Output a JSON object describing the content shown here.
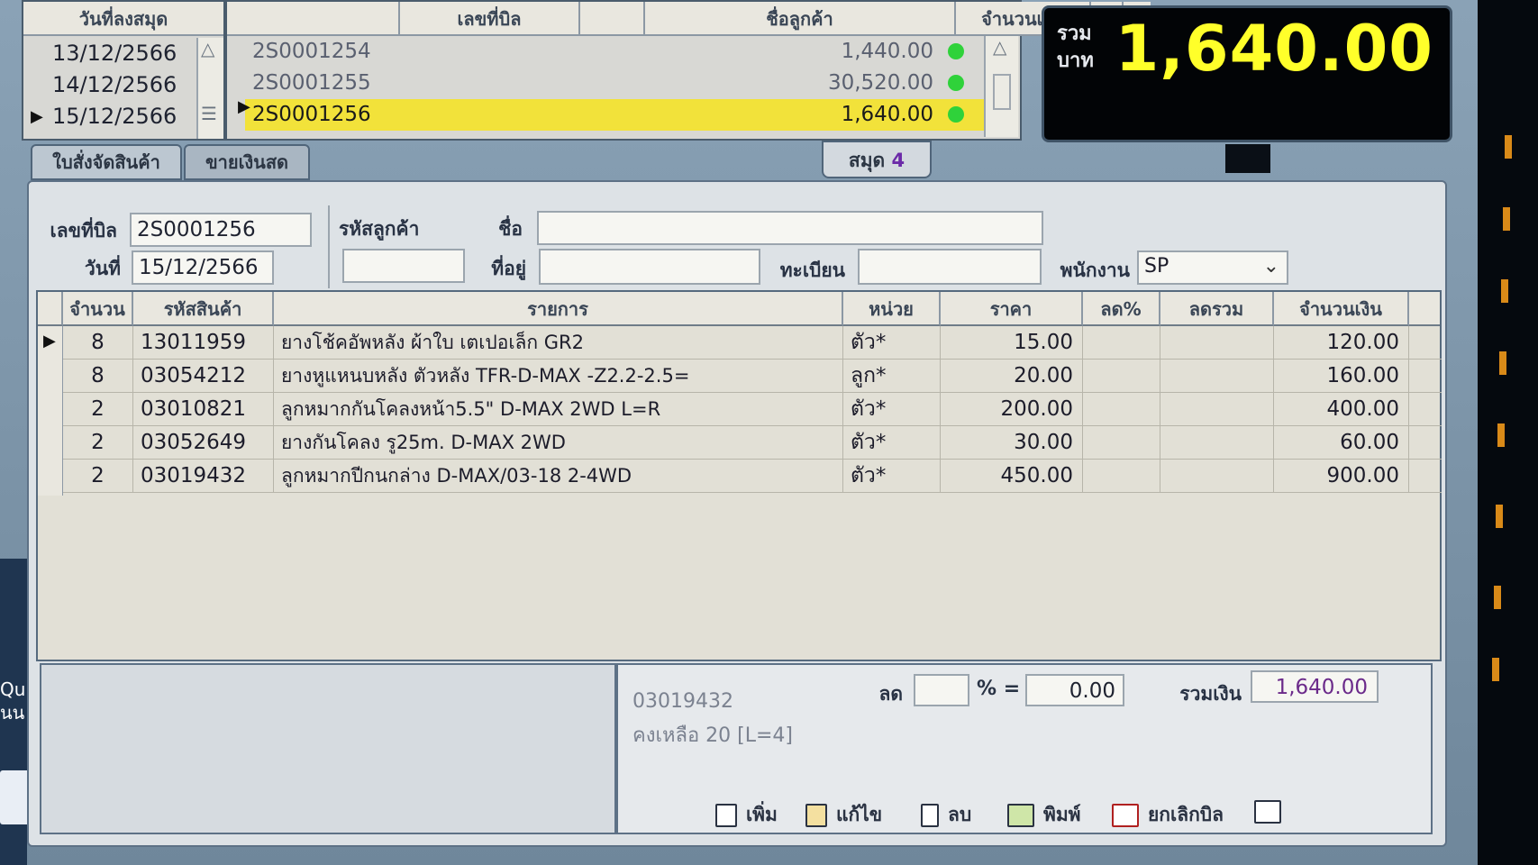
{
  "date_list": {
    "header": "วันที่ลงสมุด",
    "dates": [
      "13/12/2566",
      "14/12/2566",
      "15/12/2566"
    ],
    "selected_index": 2
  },
  "bill_list": {
    "headers": {
      "bill_no": "เลขที่บิล",
      "customer": "ชื่อลูกค้า",
      "amount": "จำนวนเงิน",
      "refresh_icon": "refresh-icon",
      "alert": "!!"
    },
    "rows": [
      {
        "bill_no": "2S0001254",
        "customer": "",
        "amount": "1,440.00",
        "status_color": "#2fd23a"
      },
      {
        "bill_no": "2S0001255",
        "customer": "",
        "amount": "30,520.00",
        "status_color": "#2fd23a"
      },
      {
        "bill_no": "2S0001256",
        "customer": "",
        "amount": "1,640.00",
        "status_color": "#2fd23a"
      }
    ],
    "selected_index": 2
  },
  "total": {
    "label_line1": "รวม",
    "label_line2": "บาท",
    "value": "1,640.00"
  },
  "tabs": {
    "delivery_order": "ใบสั่งจัดสินค้า",
    "cash_sale": "ขายเงินสด"
  },
  "book": {
    "label": "สมุด",
    "number": "4"
  },
  "form": {
    "bill_no_label": "เลขที่บิล",
    "bill_no": "2S0001256",
    "date_label": "วันที่",
    "date": "15/12/2566",
    "customer_code_label": "รหัสลูกค้า",
    "customer_code": "",
    "name_label": "ชื่อ",
    "name": "",
    "address_label": "ที่อยู่",
    "address": "",
    "registration_label": "ทะเบียน",
    "registration": "",
    "staff_label": "พนักงาน",
    "staff": "SP"
  },
  "grid": {
    "headers": {
      "qty": "จำนวน",
      "code": "รหัสสินค้า",
      "desc": "รายการ",
      "unit": "หน่วย",
      "price": "ราคา",
      "disc_pct": "ลด%",
      "disc_total": "ลดรวม",
      "amount": "จำนวนเงิน"
    },
    "rows": [
      {
        "qty": "8",
        "code": "13011959",
        "desc": "ยางโช้คอัพหลัง ผ้าใบ  เตเปอเล็ก GR2",
        "unit": "ตัว*",
        "price": "15.00",
        "disc_pct": "",
        "disc_total": "",
        "amount": "120.00"
      },
      {
        "qty": "8",
        "code": "03054212",
        "desc": "ยางหูแหนบหลัง ตัวหลัง  TFR-D-MAX -Z2.2-2.5=",
        "unit": "ลูก*",
        "price": "20.00",
        "disc_pct": "",
        "disc_total": "",
        "amount": "160.00"
      },
      {
        "qty": "2",
        "code": "03010821",
        "desc": "ลูกหมากกันโคลงหน้า5.5\" D-MAX 2WD  L=R",
        "unit": "ตัว*",
        "price": "200.00",
        "disc_pct": "",
        "disc_total": "",
        "amount": "400.00"
      },
      {
        "qty": "2",
        "code": "03052649",
        "desc": "ยางกันโคลง รู25m.  D-MAX 2WD",
        "unit": "ตัว*",
        "price": "30.00",
        "disc_pct": "",
        "disc_total": "",
        "amount": "60.00"
      },
      {
        "qty": "2",
        "code": "03019432",
        "desc": "ลูกหมากปีกนกล่าง  D-MAX/03-18 2-4WD",
        "unit": "ตัว*",
        "price": "450.00",
        "disc_pct": "",
        "disc_total": "",
        "amount": "900.00"
      }
    ]
  },
  "footer": {
    "item_code": "03019432",
    "stock_text": "คงเหลือ  20  [L=4]",
    "discount_label": "ลด",
    "discount_pct": "",
    "pct_sign": "% =",
    "discount_value": "0.00",
    "sum_label": "รวมเงิน",
    "sum_value": "1,640.00",
    "toolbar": {
      "add": "เพิ่ม",
      "edit": "แก้ไข",
      "delete": "ลบ",
      "print": "พิมพ์",
      "cancel_bill": "ยกเลิกบิล"
    }
  },
  "desktop": {
    "side_text_1": "Qu",
    "side_text_2": "นน"
  },
  "colors": {
    "accent_yellow": "#ffff2a",
    "selection": "#f2e23a",
    "status_green": "#2fd23a",
    "book_number": "#6b2aa8"
  }
}
